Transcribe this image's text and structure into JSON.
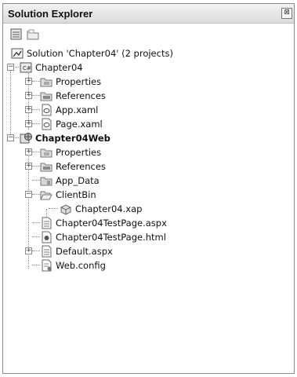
{
  "panel": {
    "title": "Solution Explorer",
    "close_glyph": "⊠"
  },
  "toolbar": {
    "buttons": [
      {
        "icon": "properties-icon"
      },
      {
        "icon": "show-all-files-icon"
      }
    ]
  },
  "tree": {
    "solution": "Solution 'Chapter04' (2 projects)",
    "project1": {
      "name": "Chapter04",
      "items": [
        "Properties",
        "References",
        "App.xaml",
        "Page.xaml"
      ]
    },
    "project2": {
      "name": "Chapter04Web",
      "items": [
        "Properties",
        "References",
        "App_Data",
        "ClientBin",
        "Chapter04.xap",
        "Chapter04TestPage.aspx",
        "Chapter04TestPage.html",
        "Default.aspx",
        "Web.config"
      ]
    }
  }
}
